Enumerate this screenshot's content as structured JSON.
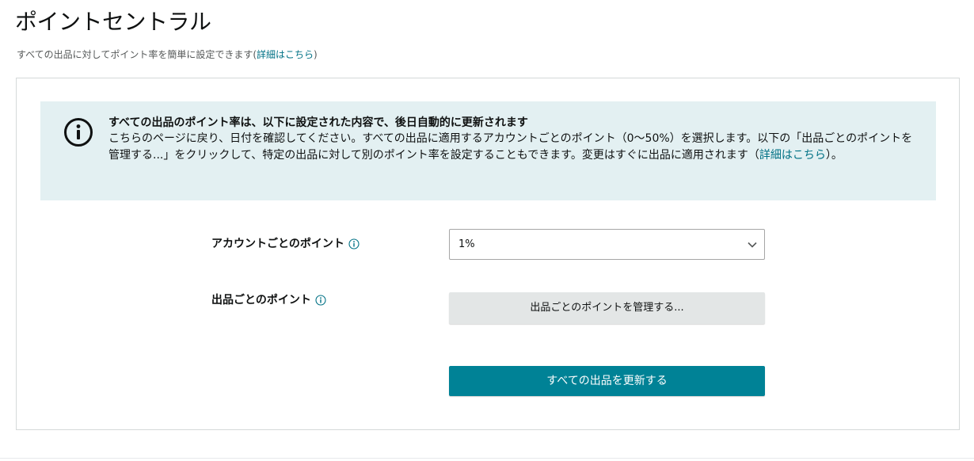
{
  "header": {
    "title": "ポイントセントラル",
    "subtitle_prefix": "すべての出品に対してポイント率を簡単に設定できます(",
    "subtitle_link": "詳細はこちら",
    "subtitle_suffix": ")"
  },
  "alert": {
    "icon": "info-circle-icon",
    "title": "すべての出品のポイント率は、以下に設定された内容で、後日自動的に更新されます",
    "body": "こちらのページに戻り、日付を確認してください。すべての出品に適用するアカウントごとのポイント（0〜50%）を選択します。以下の「出品ごとのポイントを管理する...」をクリックして、特定の出品に対して別のポイント率を設定することもできます。変更はすぐに出品に適用されます（",
    "body_link": "詳細はこちら",
    "body_suffix": "）。"
  },
  "account_points": {
    "label": "アカウントごとのポイント",
    "selected_value": "1%"
  },
  "listing_points": {
    "label": "出品ごとのポイント",
    "manage_button_label": "出品ごとのポイントを管理する..."
  },
  "update_button_label": "すべての出品を更新する",
  "colors": {
    "primary": "#008296",
    "alert_background": "#e3f0f2",
    "link": "#007185"
  }
}
